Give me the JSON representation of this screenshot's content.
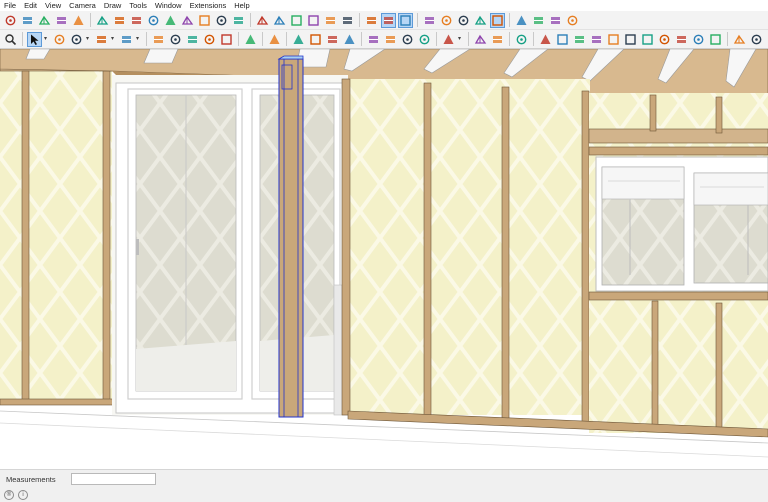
{
  "menu": [
    "File",
    "Edit",
    "View",
    "Camera",
    "Draw",
    "Tools",
    "Window",
    "Extensions",
    "Help"
  ],
  "status": {
    "measurements_label": "Measurements",
    "measurements_value": "",
    "icon_geo": "®",
    "icon_info": "i"
  },
  "colors": {
    "insulation": "#f4f1c9",
    "insulation_lattice": "#fbf9e6",
    "stud": "#c9a77a",
    "stud_edge": "#6d5638",
    "header_beam": "#d2b48c",
    "rafter": "#f5f5f5",
    "door_frame": "#ffffff",
    "door_glass": "#d8d8cf",
    "selection": "#2233cc",
    "toolbar_bg": "#f3f3f3"
  },
  "toolbar_row1": [
    {
      "icon": "select-icon",
      "active": false
    },
    {
      "icon": "move-icon",
      "active": false
    },
    {
      "icon": "arc-icon",
      "active": false
    },
    {
      "icon": "dimension-icon",
      "active": false
    },
    {
      "icon": "3d-text-icon",
      "active": false
    },
    {
      "icon": "sep"
    },
    {
      "icon": "section-plane-icon",
      "active": false
    },
    {
      "icon": "follow-me-icon",
      "active": false
    },
    {
      "icon": "zoom-icon",
      "active": false
    },
    {
      "icon": "zoom-window-icon",
      "active": false
    },
    {
      "icon": "zoom-extents-icon",
      "active": false
    },
    {
      "icon": "previous-view-icon",
      "active": false
    },
    {
      "icon": "orbit-icon",
      "active": false
    },
    {
      "icon": "look-around-icon",
      "active": false
    },
    {
      "icon": "walk-icon",
      "active": false
    },
    {
      "icon": "sep"
    },
    {
      "icon": "iso-view-icon",
      "active": false
    },
    {
      "icon": "top-view-icon",
      "active": false
    },
    {
      "icon": "front-view-icon",
      "active": false
    },
    {
      "icon": "right-view-icon",
      "active": false
    },
    {
      "icon": "back-view-icon",
      "active": false
    },
    {
      "icon": "left-view-icon",
      "active": false
    },
    {
      "icon": "sep"
    },
    {
      "icon": "axes-icon",
      "active": false
    },
    {
      "icon": "xray-icon",
      "active": true
    },
    {
      "icon": "back-edges-icon",
      "active": true
    },
    {
      "icon": "sep"
    },
    {
      "icon": "wireframe-icon",
      "active": false
    },
    {
      "icon": "hidden-line-icon",
      "active": false
    },
    {
      "icon": "shaded-icon",
      "active": false
    },
    {
      "icon": "textured-icon",
      "active": false
    },
    {
      "icon": "monochrome-icon",
      "active": true
    },
    {
      "icon": "sep"
    },
    {
      "icon": "sandbox-icon",
      "active": false
    },
    {
      "icon": "warehouse-icon",
      "active": false
    },
    {
      "icon": "extension-warehouse-icon",
      "active": false
    },
    {
      "icon": "share-model-icon",
      "active": false
    }
  ],
  "toolbar_row2": [
    {
      "icon": "search-icon",
      "active": false
    },
    {
      "icon": "sep"
    },
    {
      "icon": "select-arrow-icon",
      "active": true
    },
    {
      "icon": "dropdown"
    },
    {
      "icon": "eraser-icon",
      "active": false
    },
    {
      "icon": "pencil-icon",
      "active": false
    },
    {
      "icon": "dropdown"
    },
    {
      "icon": "line-icon",
      "active": false
    },
    {
      "icon": "dropdown"
    },
    {
      "icon": "rectangle-icon",
      "active": false
    },
    {
      "icon": "dropdown"
    },
    {
      "icon": "sep"
    },
    {
      "icon": "push-pull-icon",
      "active": false
    },
    {
      "icon": "offset-icon",
      "active": false
    },
    {
      "icon": "move-tool-icon",
      "active": false
    },
    {
      "icon": "rotate-icon",
      "active": false
    },
    {
      "icon": "scale-icon",
      "active": false
    },
    {
      "icon": "sep"
    },
    {
      "icon": "tape-measure-icon",
      "active": false
    },
    {
      "icon": "sep"
    },
    {
      "icon": "paint-bucket-icon",
      "active": false
    },
    {
      "icon": "sep"
    },
    {
      "icon": "section-icon",
      "active": false
    },
    {
      "icon": "orbit-tool-icon",
      "active": false
    },
    {
      "icon": "zoom-tool-icon",
      "active": false
    },
    {
      "icon": "zoom-extents-tool-icon",
      "active": false
    },
    {
      "icon": "sep"
    },
    {
      "icon": "component-icon",
      "active": false
    },
    {
      "icon": "materials-icon",
      "active": false
    },
    {
      "icon": "styles-icon",
      "active": false
    },
    {
      "icon": "layers-icon",
      "active": false
    },
    {
      "icon": "sep"
    },
    {
      "icon": "geo-location-icon",
      "active": false
    },
    {
      "icon": "dropdown"
    },
    {
      "icon": "sep"
    },
    {
      "icon": "new-file-icon",
      "active": false
    },
    {
      "icon": "user-icon",
      "active": false
    },
    {
      "icon": "sep"
    },
    {
      "icon": "layout-icon",
      "active": false
    },
    {
      "icon": "sep"
    },
    {
      "icon": "framing-icon",
      "active": false
    },
    {
      "icon": "joist-icon",
      "active": false
    },
    {
      "icon": "roof-icon",
      "active": false
    },
    {
      "icon": "wall-icon",
      "active": false
    },
    {
      "icon": "truss-icon",
      "active": false
    },
    {
      "icon": "floor-icon",
      "active": false
    },
    {
      "icon": "stair-icon",
      "active": false
    },
    {
      "icon": "window-icon",
      "active": false
    },
    {
      "icon": "door-icon",
      "active": false
    },
    {
      "icon": "column-icon",
      "active": false
    },
    {
      "icon": "foundation-icon",
      "active": false
    },
    {
      "icon": "sep"
    },
    {
      "icon": "estimate-icon",
      "active": false
    },
    {
      "icon": "export-icon",
      "active": false
    }
  ]
}
